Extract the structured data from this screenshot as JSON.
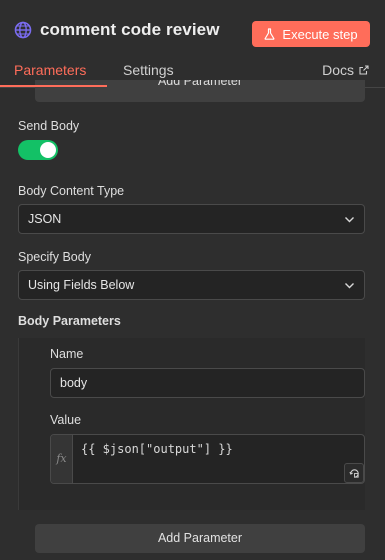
{
  "node": {
    "title": "comment code review",
    "execute_label": "Execute step",
    "icon": "globe-icon"
  },
  "tabs": [
    {
      "label": "Parameters"
    },
    {
      "label": "Settings"
    },
    {
      "label": "Docs"
    }
  ],
  "top_add_label": "Add Parameter",
  "send_body": {
    "label": "Send Body",
    "enabled": true
  },
  "body_content_type": {
    "label": "Body Content Type",
    "value": "JSON"
  },
  "specify_body": {
    "label": "Specify Body",
    "value": "Using Fields Below"
  },
  "body_parameters": {
    "label": "Body Parameters",
    "name_label": "Name",
    "name_value": "body",
    "value_label": "Value",
    "fx_label": "fx",
    "value_expression": "{{ $json[\"output\"] }}",
    "add_label": "Add Parameter"
  },
  "colors": {
    "accent": "#ff6d5a",
    "toggle_on": "#13c166",
    "globe": "#7b6cf0"
  }
}
